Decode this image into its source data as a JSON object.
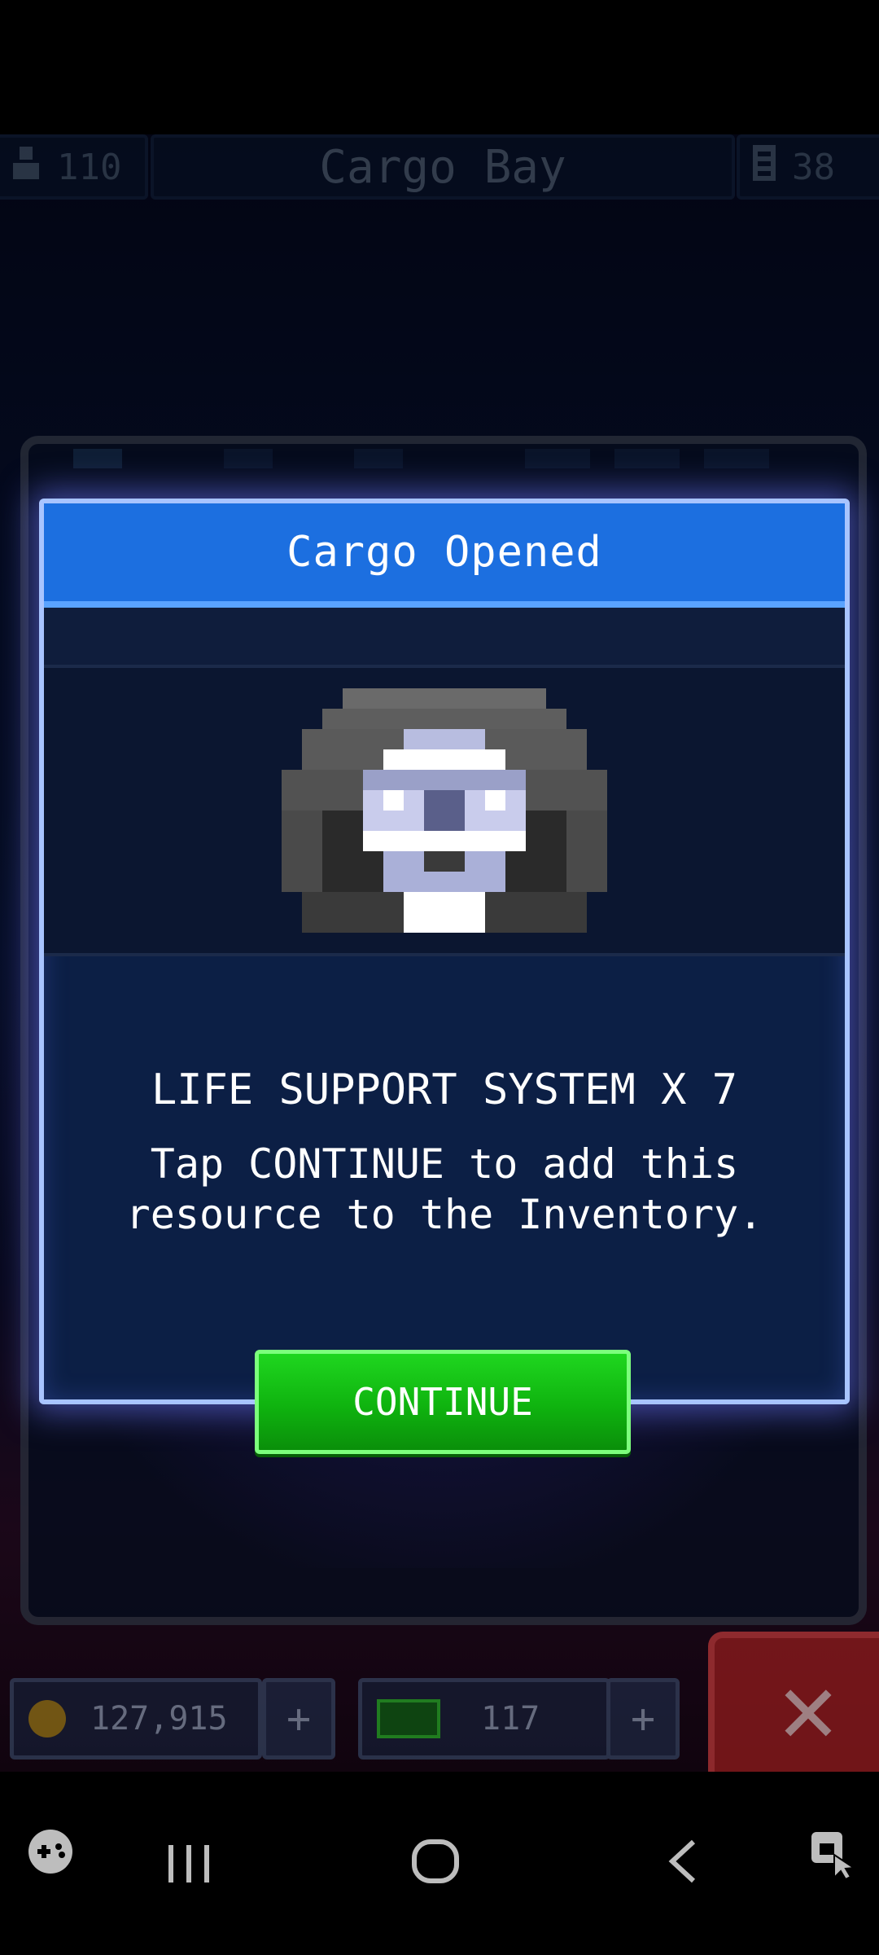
{
  "header": {
    "crew_count": "110",
    "title": "Cargo Bay",
    "storage_count": "38"
  },
  "dialog": {
    "title": "Cargo Opened",
    "item_name": "LIFE SUPPORT SYSTEM X 7",
    "description": "Tap CONTINUE to add this resource to the Inventory.",
    "button": "CONTINUE"
  },
  "currency": {
    "coins": "127,915",
    "gems": "117",
    "plus": "+"
  },
  "close_glyph": "✕",
  "navbar": {
    "game_tools": "game-tools-icon",
    "recents": "|||",
    "home": "○",
    "back": "<",
    "assistant": "screen-assistant-icon"
  },
  "colors": {
    "title_bar": "#1c6fe0",
    "dialog_bg": "#0c1f45",
    "button_green": "#0fb30f",
    "border_glow": "#a8c4ff"
  }
}
